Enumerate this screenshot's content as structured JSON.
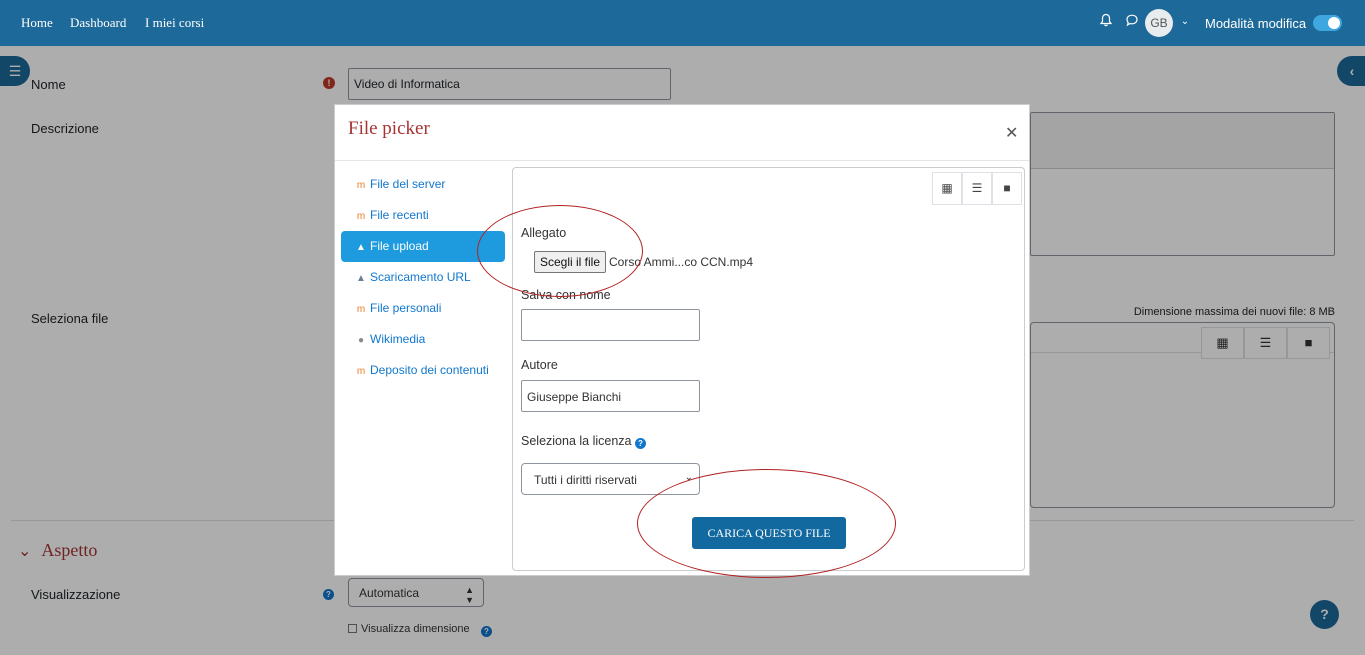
{
  "navbar": {
    "links": [
      "Home",
      "Dashboard",
      "I miei corsi"
    ],
    "avatar_initials": "GB",
    "edit_mode_label": "Modalità modifica"
  },
  "form": {
    "nome_label": "Nome",
    "nome_value": "Video di Informatica",
    "descrizione_label": "Descrizione",
    "seleziona_file_label": "Seleziona file",
    "max_size_text": "Dimensione massima dei nuovi file: 8 MB",
    "section_title": "Aspetto",
    "visualizzazione_label": "Visualizzazione",
    "visualizzazione_value": "Automatica",
    "visualizza_dimensione_label": "Visualizza dimensione"
  },
  "modal": {
    "title": "File picker",
    "repositories": [
      {
        "label": "File del server",
        "icon": "moodle-icon",
        "active": false
      },
      {
        "label": "File recenti",
        "icon": "moodle-icon",
        "active": false
      },
      {
        "label": "File upload",
        "icon": "upload-icon",
        "active": true
      },
      {
        "label": "Scaricamento URL",
        "icon": "download-url-icon",
        "active": false
      },
      {
        "label": "File personali",
        "icon": "moodle-icon",
        "active": false
      },
      {
        "label": "Wikimedia",
        "icon": "wikimedia-icon",
        "active": false
      },
      {
        "label": "Deposito dei contenuti",
        "icon": "moodle-icon",
        "active": false
      }
    ],
    "upload": {
      "allegato_label": "Allegato",
      "choose_button": "Scegli il file",
      "chosen_file": "Corso Ammi...co CCN.mp4",
      "salva_label": "Salva con nome",
      "salva_value": "",
      "autore_label": "Autore",
      "autore_value": "Giuseppe Bianchi",
      "licenza_label": "Seleziona la licenza",
      "licenza_value": "Tutti i diritti riservati",
      "upload_button": "CARICA QUESTO FILE"
    }
  },
  "colors": {
    "navbar": "#1d6999",
    "accent_red": "#a63434",
    "active_repo": "#1d9bde",
    "link": "#1177cc"
  }
}
